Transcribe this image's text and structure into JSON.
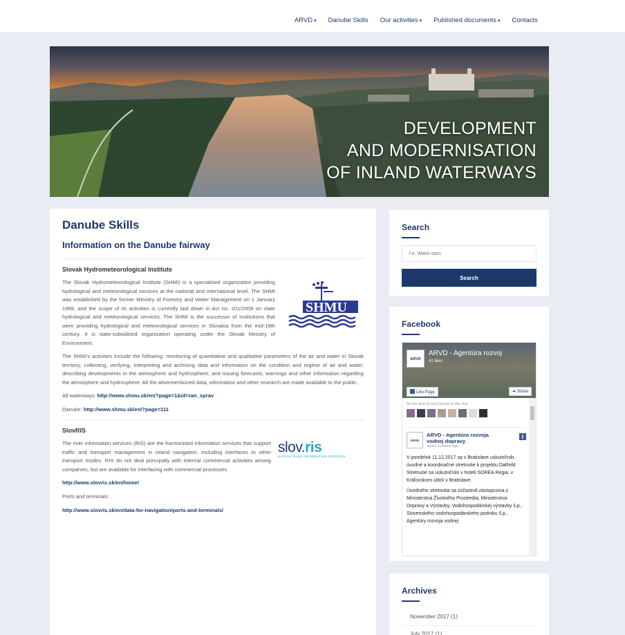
{
  "nav": {
    "items": [
      {
        "label": "ARVD",
        "dropdown": true
      },
      {
        "label": "Danube Skills",
        "dropdown": false
      },
      {
        "label": "Our activities",
        "dropdown": true
      },
      {
        "label": "Published documents",
        "dropdown": true
      },
      {
        "label": "Contacts",
        "dropdown": false
      }
    ],
    "caret_icon": "chevron-down-icon"
  },
  "hero": {
    "line1": "DEVELOPMENT",
    "line2": "AND MODERNISATION",
    "line3": "OF INLAND WATERWAYS"
  },
  "main": {
    "title": "Danube Skills",
    "subtitle": "Information on the Danube fairway",
    "shmi": {
      "heading": "Slovak Hydrometeorological Institute",
      "logo_text": "SHMU",
      "p1": "The Slovak Hydrometeorological Institute (SHMI) is a specialized organization providing hydrological and meteorological services at the national and international level. The SHMI was established by the former Ministry of Forestry and Water Management on 1 January 1969, and the scope of its activities is currently laid down in Act no. 201/2009 on state hydrological and meteorological services. The SHMI is the successor of institutions that were providing hydrological and meteorological services in Slovakia from the mid-19th century. It is state-subsidised organisation operating under the Slovak Ministry of Environment.",
      "p2": "The SHMI's activities include the following: monitoring of quantitative and qualitative parameters of the air and water in Slovak territory; collecting, verifying, interpreting and archiving data and information on the condition and regime of air and water; describing developments in the atmosphere and hydrosphere; and issuing forecasts, warnings and other information regarding the atmosphere and hydrosphere. All the aforementioned data, information and other research are made available to the public.",
      "all_label": "All waterways: ",
      "all_link": "http://www.shmu.sk/en/?page=1&id=ran_sprav",
      "danube_label": "Danube: ",
      "danube_link": "http://www.shmu.sk/en/?page=111"
    },
    "slovris": {
      "heading": "SlovRIS",
      "logo_slov": "slov.",
      "logo_ris": "ris",
      "logo_tagline": "SLOVAK RIVER INFORMATION SERVICES",
      "p1": "The river information services (RIS) are the harmonised information services that support traffic and transport management in inland navigation, including interfaces to other transport modes. RIS do not deal principally with internal commercial activities among companies, but are available for interfacing with commercial processes.",
      "link1": "http://www.slovris.sk/en/home/",
      "ports_label": "Ports and terminals:",
      "link2": "http://www.slovris.sk/en/data-for-navigation/ports-and-terminals/"
    }
  },
  "search": {
    "title": "Search",
    "placeholder": "f.e. Water dam",
    "button": "Search"
  },
  "facebook": {
    "title": "Facebook",
    "page_name": "ARVD - Agentúra rozvoj",
    "likes": "41 likes",
    "like_button": "Like Page",
    "share_button": "Share",
    "first_friends": "Be the first of your friends to like this",
    "logo_text": "ARVD",
    "post_author": "ARVD - Agentúra rozvoja vodnej dopravy",
    "post_time": "about 3 weeks ago",
    "post_p1": "V pondelok 11.12.2017 sa v Bratislave uskutočnilo úvodné a koordinačné stretnutie k projektu DaReM. Stretnutie sa uskutočnilo v hoteli SOREA Regia, v Kráľovskom údolí v Bratislave.",
    "post_p2": "Úvodného stretnutia sa zúčastnili zástupcovia z Ministerstva Životného Prostredia, Ministerstva Dopravy a Výstavby, Vodohospodárskej výstavby š.p., Slovenského vodohospodárskeho podniku š.p., Agentúry rozvoja vodnej"
  },
  "archives": {
    "title": "Archives",
    "items": [
      "November 2017 (1)",
      "July 2017 (1)"
    ]
  }
}
